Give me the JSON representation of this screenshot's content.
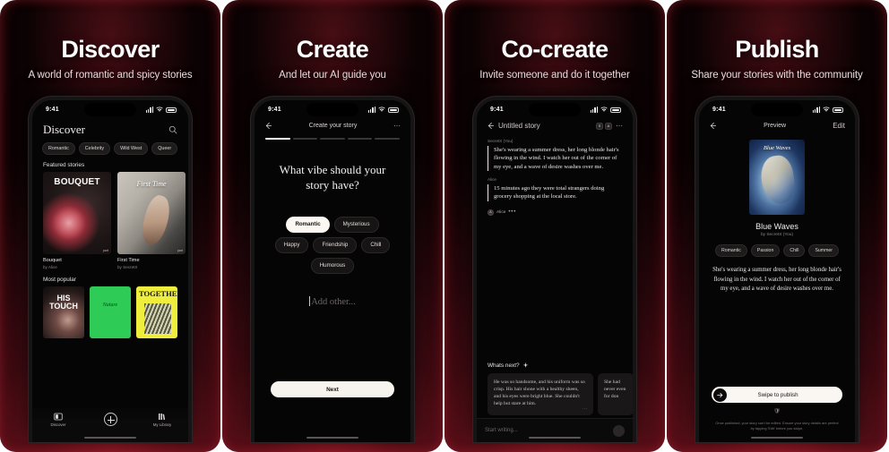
{
  "panels": [
    {
      "headline": "Discover",
      "subhead": "A world of romantic and spicy stories",
      "status": {
        "time": "9:41"
      },
      "screen_title": "Discover",
      "search_icon": "search-icon",
      "filter_chips": [
        "Romantic",
        "Celebrity",
        "Wild West",
        "Queer"
      ],
      "featured_label": "Featured stories",
      "featured": [
        {
          "cover_title": "BOUQUET",
          "name": "Bouquet",
          "by": "by Alice",
          "badge": "part"
        },
        {
          "cover_title": "First Time",
          "name": "First Time",
          "by": "by SecretX",
          "badge": "part"
        }
      ],
      "popular_label": "Most popular",
      "popular": [
        {
          "cover_title": "HIS TOUCH"
        },
        {
          "cover_title": "Nature"
        },
        {
          "cover_title": "TOGETHER"
        }
      ],
      "tabs": [
        {
          "label": "Discover",
          "icon": "discover-icon"
        },
        {
          "label": "",
          "icon": "plus-icon"
        },
        {
          "label": "My Library",
          "icon": "library-icon"
        }
      ]
    },
    {
      "headline": "Create",
      "subhead": "And let our AI guide you",
      "status": {
        "time": "9:41"
      },
      "nav_title": "Create your story",
      "nav_back": "back-arrow-icon",
      "nav_more": "···",
      "progress": {
        "total": 5,
        "filled": 1
      },
      "question": "What vibe should your story have?",
      "vibes": [
        "Romantic",
        "Mysterious",
        "Happy",
        "Friendship",
        "Chill",
        "Humorous"
      ],
      "selected_vibe": "Romantic",
      "add_other_placeholder": "Add other...",
      "next_label": "Next"
    },
    {
      "headline": "Co-create",
      "subhead": "Invite someone and do it together",
      "status": {
        "time": "9:41"
      },
      "nav_title": "Untitled story",
      "nav_back": "back-arrow-icon",
      "collaborators": [
        "S",
        "A"
      ],
      "nav_more": "···",
      "messages": [
        {
          "author": "SecretX (You)",
          "text": "She's wearing a summer dress, her long blonde hair's flowing in the wind. I watch her out of the corner of my eye, and a wave of desire washes over me."
        },
        {
          "author": "Alice",
          "text": "15 minutes ago they were total strangers doing grocery shopping at the local store."
        }
      ],
      "typing_row": {
        "avatar": "A",
        "name": "Alice",
        "ellipsis": "•••"
      },
      "whats_next_label": "Whats next?",
      "whats_next_icon": "sparkles-icon",
      "suggestions": [
        {
          "text": "He was so handsome, and his uniform was so crisp. His hair shone with a healthy sheen, and his eyes were bright blue. She couldn't help but stare at him.",
          "dots": "···"
        },
        {
          "text": "She had never even for don",
          "dots": ""
        }
      ],
      "composer_placeholder": "Start writing...",
      "send_icon": "send-icon"
    },
    {
      "headline": "Publish",
      "subhead": "Share your stories with the community",
      "status": {
        "time": "9:41"
      },
      "nav_back": "back-arrow-icon",
      "nav_title": "Preview",
      "nav_action": "Edit",
      "cover_title": "Blue Waves",
      "story_name": "Blue Waves",
      "story_by": "by SecretX (You)",
      "tags": [
        "Romantic",
        "Passion",
        "Chill",
        "Summer"
      ],
      "story_text": "She's wearing a summer dress, her long blonde hair's flowing in the wind. I watch her out of the corner of my eye, and a wave of desire washes over me.",
      "swipe_label": "Swipe to publish",
      "swipe_icon": "arrow-right-icon",
      "shield_icon": "shield-icon",
      "fineprint": "Once published, your story can't be edited. Ensure your story details are perfect by tapping 'Edit' before you swipe."
    }
  ],
  "colors": {
    "background_deep": "#150406",
    "accent_red": "#7d1420",
    "text_primary": "#ffffff",
    "text_secondary": "#8e8686",
    "chip_selected_bg": "#f3eeea",
    "green_cover": "#2ecc56",
    "yellow_cover": "#f0ee3c"
  }
}
